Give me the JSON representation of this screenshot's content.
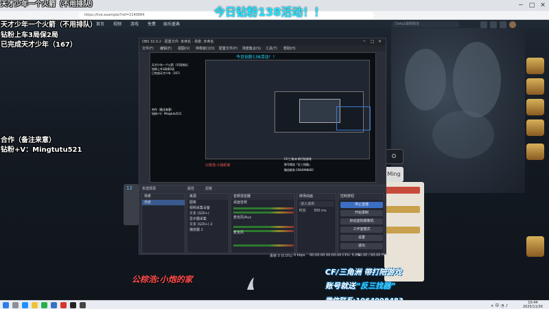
{
  "banner": "今日钻粉138活动！！",
  "overlay": {
    "line_top": "天才少年一个火箭（不用排队）",
    "line1": "天才少年一个火箭（不用排队）",
    "line2": "钻粉上车3局保2局",
    "line3": "已完成天才少年（167）",
    "line4": "合作（备注来意）",
    "line5": "钻粉+V：Mingtutu521"
  },
  "site": {
    "nav_items": [
      "首页",
      "视频",
      "游戏",
      "免费",
      "娱乐盛典"
    ],
    "search_placeholder": "Dota2最新版本",
    "url": "https://live.example/?ref=2140684"
  },
  "obs": {
    "title": "OBS 32.0.2 - 配置文件: 未命名 - 场景: 未命名",
    "menu": [
      "文件(F)",
      "编辑(E)",
      "视图(V)",
      "停靠窗口(D)",
      "配置文件(P)",
      "场景集合(S)",
      "工具(T)",
      "帮助(H)"
    ],
    "toolbar": {
      "source_label": "未选择源",
      "props": "属性",
      "filters": "滤镜"
    },
    "preview_cyan": "今日钻粉138活动！！",
    "preview_lines": [
      "天才少年一个火箭（不用排队）",
      "钻粉上车3局保2局",
      "已完成天才少年（167）",
      "合作（备注来意）",
      "钻粉+V：Mingtutu521"
    ],
    "preview_brand_left": "公棕浩:小炮的家",
    "preview_brand_right": [
      "CF/三角洲 带打陪游戏",
      "账号就送「反三找器」",
      "微信联系:1064998483"
    ],
    "scenes": {
      "title": "场景",
      "items": [
        "场景"
      ]
    },
    "sources": {
      "title": "来源",
      "items": [
        "图像",
        "视频采集设备",
        "文本 (GDI+)",
        "显示器采集",
        "文本 (GDI+) 2",
        "播放器 2"
      ]
    },
    "mixer": {
      "title": "音频混音器",
      "tracks": [
        "桌面音频",
        "麦克风/Aux",
        "麦克风"
      ]
    },
    "transitions": {
      "title": "转场动画",
      "type": "淡入淡出",
      "duration_label": "时长",
      "duration": "300 ms"
    },
    "controls": {
      "title": "控制按钮",
      "buttons": [
        "停止直播",
        "开始录制",
        "启动虚拟摄像机",
        "工作室模式",
        "设置",
        "退出"
      ]
    },
    "status": {
      "fps": "60.00 / 60.00 FPS",
      "time1": "00:00:00",
      "time2": "00:00:00",
      "cpu": "CPU: 5.0%",
      "frames": "丢帧 0 (0.0%)",
      "kbps": "0 kbps"
    }
  },
  "brand_left": "公棕浩:小炮的家",
  "brand_right": {
    "line1": "CF/三角洲 带打陪游戏",
    "line2_prefix": "账号就送",
    "line2_hl": "“反三找器”",
    "line3": "微信联系:1064998483"
  },
  "chat": {
    "tile_number": "12",
    "ming_label": "Ming",
    "o_label": "O"
  },
  "taskbar": {
    "time": "10:44",
    "date": "2025/11/30",
    "tray": "∧  中  ◔  ♪"
  }
}
